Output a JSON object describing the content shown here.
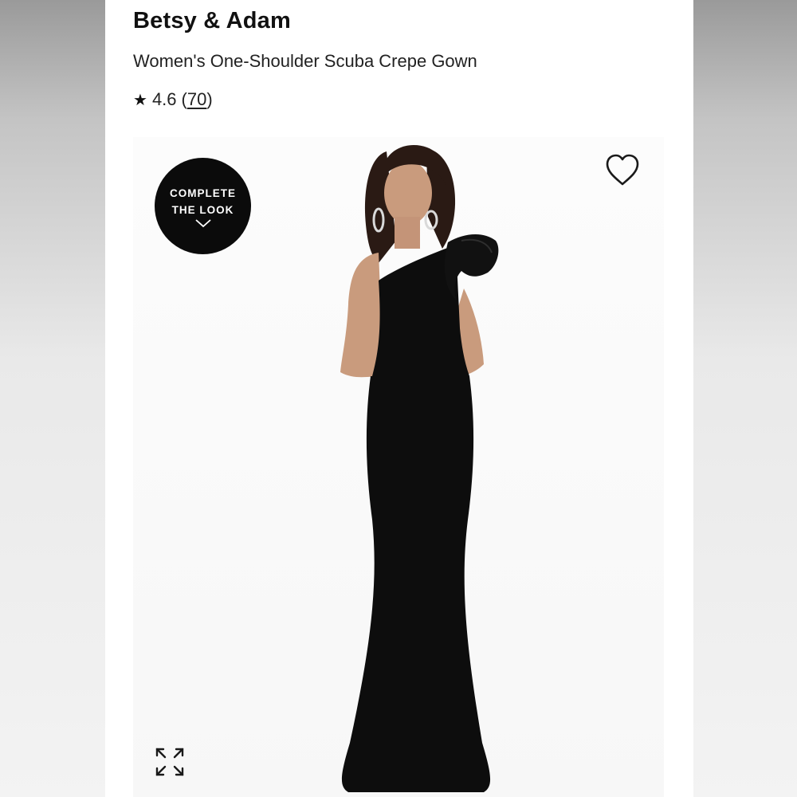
{
  "product": {
    "brand": "Betsy & Adam",
    "name": "Women's One-Shoulder Scuba Crepe Gown",
    "rating": {
      "star_icon": "star-icon",
      "value": "4.6",
      "open_paren": "(",
      "count": "70",
      "close_paren": ")"
    }
  },
  "image": {
    "complete_look": {
      "line1": "COMPLETE",
      "line2": "THE LOOK",
      "icon": "chevron-down-icon"
    },
    "favorite_icon": "heart-icon",
    "expand_icon": "expand-icon"
  },
  "colors": {
    "dress": "#0d0d0d",
    "skin": "#c99b7d",
    "hair": "#2a1a14",
    "badge": "#0b0b0b"
  }
}
